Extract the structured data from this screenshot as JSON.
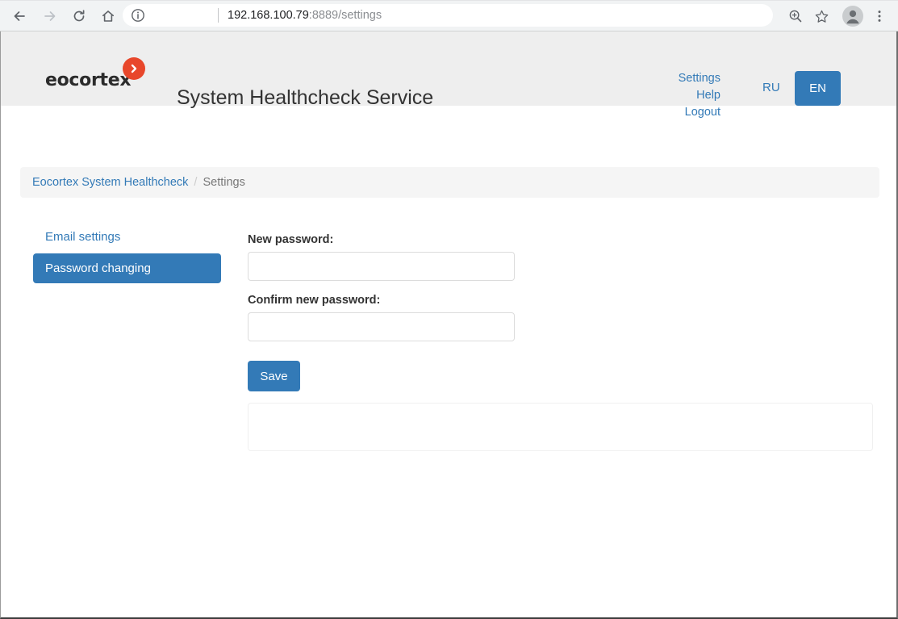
{
  "browser": {
    "back_icon": "back-arrow-icon",
    "forward_icon": "forward-arrow-icon",
    "reload_icon": "reload-icon",
    "home_icon": "home-icon",
    "site_info_icon": "info-circle-icon",
    "url_host": "192.168.100.79",
    "url_rest": ":8889/settings",
    "url_full": "192.168.100.79:8889/settings",
    "zoom_icon": "zoom-magnifier-icon",
    "bookmark_icon": "star-icon",
    "profile_icon": "profile-avatar-icon",
    "menu_icon": "three-dot-menu-icon"
  },
  "header": {
    "logo_text": "eocortex",
    "logo_badge_icon": "chevron-right-badge-icon",
    "title": "System Healthcheck Service",
    "links": [
      {
        "label": "Settings"
      },
      {
        "label": "Help"
      },
      {
        "label": "Logout"
      }
    ],
    "lang_inactive": "RU",
    "lang_active": "EN"
  },
  "breadcrumb": {
    "root": "Eocortex System Healthcheck",
    "separator": "/",
    "current": "Settings"
  },
  "sidebar": {
    "items": [
      {
        "label": "Email settings",
        "active": false
      },
      {
        "label": "Password changing",
        "active": true
      }
    ]
  },
  "form": {
    "new_password": {
      "label": "New password:",
      "value": "",
      "placeholder": ""
    },
    "confirm_password": {
      "label": "Confirm new password:",
      "value": "",
      "placeholder": ""
    },
    "save_label": "Save"
  },
  "colors": {
    "primary_blue": "#337ab7",
    "logo_orange": "#e8472b",
    "header_bg": "#eeeeee",
    "breadcrumb_bg": "#f5f5f5",
    "label_text": "#333333"
  }
}
